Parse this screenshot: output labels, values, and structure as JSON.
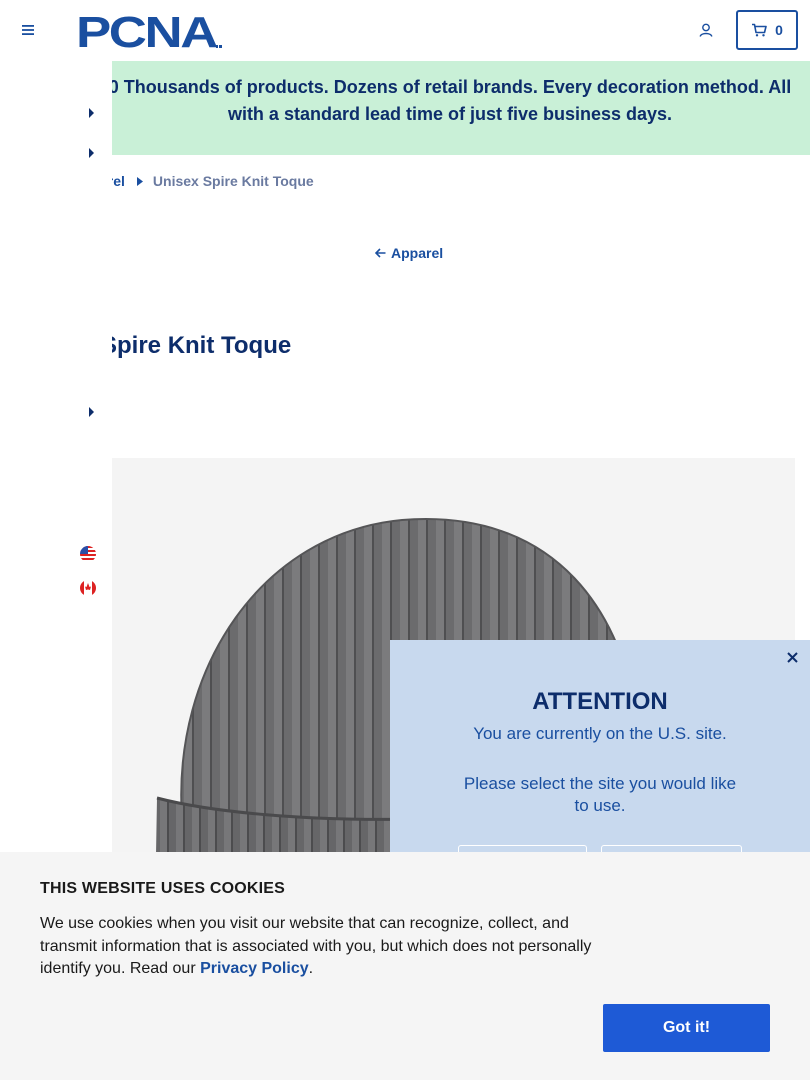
{
  "header": {
    "logo_text": "PCNA",
    "cart_count": "0"
  },
  "banner": {
    "text": "0 Thousands of products. Dozens of retail brands. Every decoration method. All with a standard lead time of just five business days."
  },
  "breadcrumb": {
    "parent": "arel",
    "current": "Unisex Spire Knit Toque"
  },
  "back_link": {
    "label": "Apparel"
  },
  "product": {
    "title": "Spire Knit Toque",
    "image_alt": "Unisex Spire Knit Toque"
  },
  "attention": {
    "title": "ATTENTION",
    "current_site": "You are currently on the U.S. site.",
    "prompt": "Please select the site you would like to use."
  },
  "cookie": {
    "title": "THIS WEBSITE USES COOKIES",
    "text": "We use cookies when you visit our website that can recognize, collect, and transmit information that is associated with you, but which does not personally identify you. Read our ",
    "link": "Privacy Policy",
    "end": ".",
    "button": "Got it!"
  },
  "colors": {
    "brand_blue": "#1a4fa0",
    "navy": "#0d2d6b",
    "banner_green": "#c9f0d7",
    "popup_blue": "#c8d9ee",
    "button_blue": "#1e5ad6"
  }
}
